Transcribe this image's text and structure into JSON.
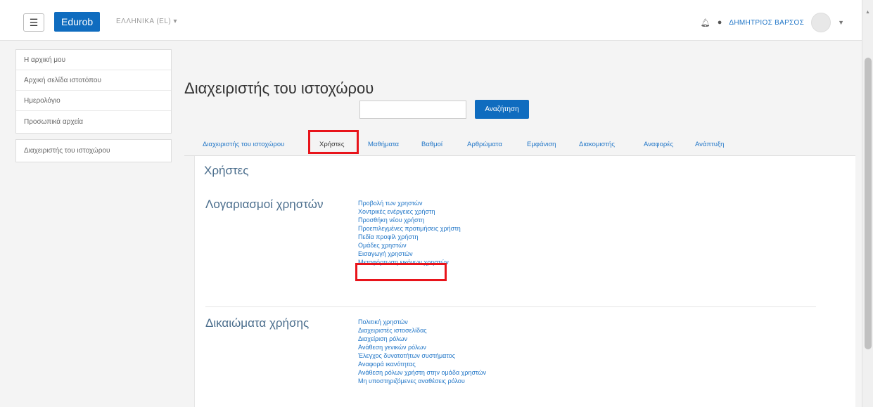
{
  "navbar": {
    "brand": "Edurob",
    "language": "ΕΛΛΗΝΙΚΑ (EL) ▾",
    "user_name": "ΔΗΜΗΤΡΙΟΣ ΒΑΡΣΟΣ",
    "menu_icon": "hamburger-icon",
    "notification_icon": "bell-icon",
    "message_icon": "chat-icon"
  },
  "sidebar": {
    "items": [
      "Η αρχική μου",
      "Αρχική σελίδα ιστοτόπου",
      "Ημερολόγιο",
      "Προσωπικά αρχεία"
    ],
    "admin_item": "Διαχειριστής του ιστοχώρου"
  },
  "main": {
    "title": "Διαχειριστής του ιστοχώρου",
    "search": {
      "placeholder": "",
      "button": "Αναζήτηση"
    },
    "tabs": [
      "Διαχειριστής του ιστοχώρου",
      "Χρήστες",
      "Μαθήματα",
      "Βαθμοί",
      "Αρθρώματα",
      "Εμφάνιση",
      "Διακομιστής",
      "Αναφορές",
      "Ανάπτυξη"
    ],
    "active_tab": "Χρήστες",
    "section_title": "Χρήστες",
    "categories": [
      {
        "title": "Λογαριασμοί χρηστών",
        "links": [
          "Προβολή των χρηστών",
          "Χοντρικές ενέργειες χρήστη",
          "Προσθήκη νέου χρήστη",
          "Προεπιλεγμένες προτιμήσεις χρήστη",
          "Πεδία προφίλ χρήστη",
          "Ομάδες χρηστών",
          "Εισαγωγή χρηστών",
          "Μεταφόρτωση εικόνων χρηστών"
        ]
      },
      {
        "title": "Δικαιώματα χρήσης",
        "links": [
          "Πολιτική χρηστών",
          "Διαχειριστές ιστοσελίδας",
          "Διαχείριση ρόλων",
          "Ανάθεση γενικών ρόλων",
          "Έλεγχος δυνατοτήτων συστήματος",
          "Αναφορά ικανότητας",
          "Ανάθεση ρόλων χρήστη στην ομάδα χρηστών",
          "Μη υποστηριζόμενες αναθέσεις ρόλου"
        ]
      }
    ]
  },
  "colors": {
    "brand": "#0f6cbf",
    "link": "#2176c7",
    "highlight": "#e8141b",
    "heading": "#4a6d8c"
  }
}
